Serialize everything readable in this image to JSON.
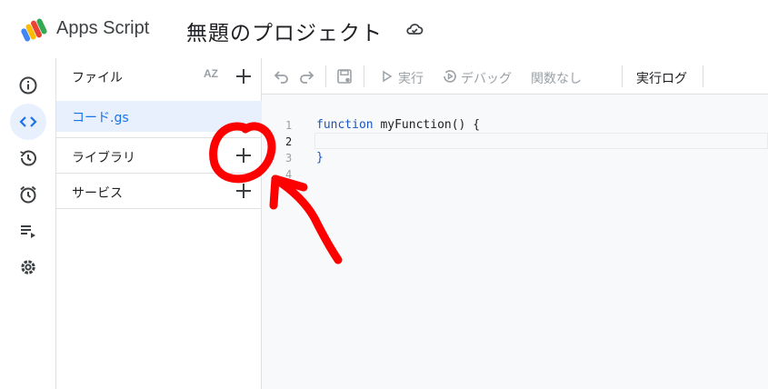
{
  "app": {
    "name": "Apps Script",
    "project_title": "無題のプロジェクト"
  },
  "rail": {
    "items": [
      {
        "icon": "info-icon",
        "active": false
      },
      {
        "icon": "code-icon",
        "active": true
      },
      {
        "icon": "history-icon",
        "active": false
      },
      {
        "icon": "alarm-icon",
        "active": false
      },
      {
        "icon": "executions-icon",
        "active": false
      },
      {
        "icon": "gear-icon",
        "active": false
      }
    ]
  },
  "files_panel": {
    "title": "ファイル",
    "sort_icon_text": "AZ",
    "files": [
      {
        "name": "コード.gs"
      }
    ],
    "sections": [
      {
        "label": "ライブラリ"
      },
      {
        "label": "サービス"
      }
    ]
  },
  "toolbar": {
    "run_label": "実行",
    "debug_label": "デバッグ",
    "function_select": "関数なし",
    "log_label": "実行ログ"
  },
  "editor": {
    "lines": [
      "1",
      "2",
      "3",
      "4"
    ],
    "code": {
      "keyword": "function",
      "signature": " myFunction() {",
      "close": "}"
    }
  },
  "annotation": {
    "color": "#ff0000"
  },
  "colors": {
    "accent": "#1a73e8",
    "active_bg": "#e8f0fe"
  }
}
